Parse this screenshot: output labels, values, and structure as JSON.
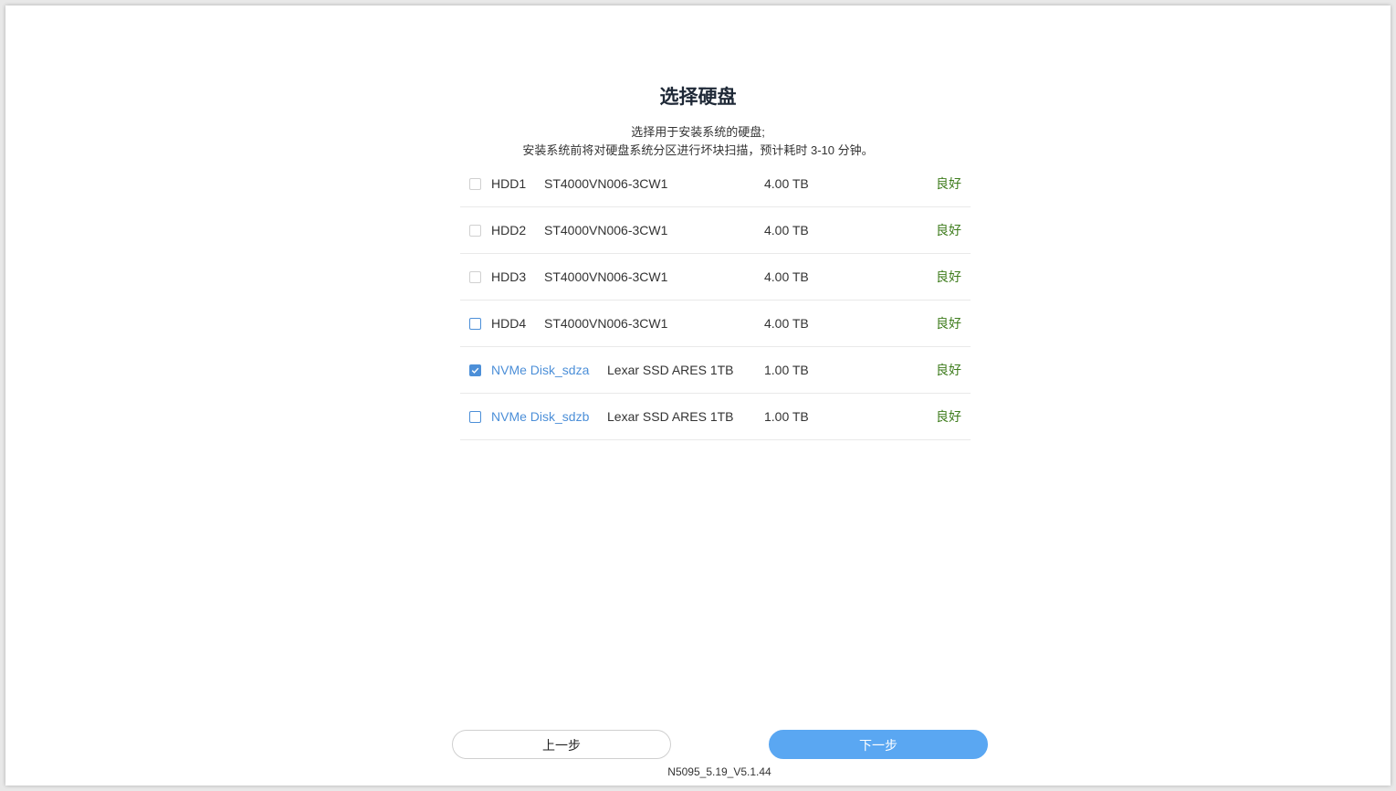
{
  "page": {
    "title": "选择硬盘",
    "subtitle_line1": "选择用于安装系统的硬盘;",
    "subtitle_line2": "安装系统前将对硬盘系统分区进行坏块扫描，预计耗时 3-10 分钟。"
  },
  "disks": [
    {
      "name": "HDD1",
      "model": "ST4000VN006-3CW1",
      "size": "4.00 TB",
      "status": "良好",
      "checked": false,
      "enabled": false,
      "type": "hdd"
    },
    {
      "name": "HDD2",
      "model": "ST4000VN006-3CW1",
      "size": "4.00 TB",
      "status": "良好",
      "checked": false,
      "enabled": false,
      "type": "hdd"
    },
    {
      "name": "HDD3",
      "model": "ST4000VN006-3CW1",
      "size": "4.00 TB",
      "status": "良好",
      "checked": false,
      "enabled": false,
      "type": "hdd"
    },
    {
      "name": "HDD4",
      "model": "ST4000VN006-3CW1",
      "size": "4.00 TB",
      "status": "良好",
      "checked": false,
      "enabled": true,
      "type": "hdd"
    },
    {
      "name": "NVMe Disk_sdza",
      "model": "Lexar SSD ARES 1TB",
      "size": "1.00 TB",
      "status": "良好",
      "checked": true,
      "enabled": true,
      "type": "nvme"
    },
    {
      "name": "NVMe Disk_sdzb",
      "model": "Lexar SSD ARES 1TB",
      "size": "1.00 TB",
      "status": "良好",
      "checked": false,
      "enabled": true,
      "type": "nvme"
    }
  ],
  "buttons": {
    "prev_label": "上一步",
    "next_label": "下一步"
  },
  "footer": {
    "version": "N5095_5.19_V5.1.44"
  },
  "colors": {
    "accent": "#4c8fd8",
    "primary_button": "#5aa7f2",
    "status_good": "#3f7d1e"
  }
}
